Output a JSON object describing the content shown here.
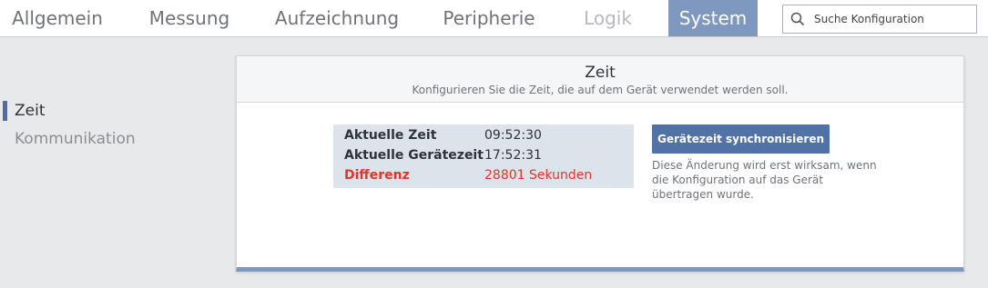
{
  "nav": {
    "tabs": [
      {
        "label": "Allgemein",
        "state": "normal"
      },
      {
        "label": "Messung",
        "state": "normal"
      },
      {
        "label": "Aufzeichnung",
        "state": "normal"
      },
      {
        "label": "Peripherie",
        "state": "normal"
      },
      {
        "label": "Logik",
        "state": "disabled"
      },
      {
        "label": "System",
        "state": "active"
      }
    ],
    "search": {
      "placeholder": "Suche Konfiguration",
      "icon": "search-icon"
    }
  },
  "sidebar": {
    "items": [
      {
        "label": "Zeit",
        "active": true
      },
      {
        "label": "Kommunikation",
        "active": false
      }
    ]
  },
  "card": {
    "title": "Zeit",
    "subtitle": "Konfigurieren Sie die Zeit, die auf dem Gerät verwendet werden soll.",
    "rows": [
      {
        "label": "Aktuelle Zeit",
        "value": "09:52:30"
      },
      {
        "label": "Aktuelle Gerätezeit",
        "value": "17:52:31"
      },
      {
        "label": "Differenz",
        "value": "28801 Sekunden"
      }
    ],
    "sync_button": "Gerätezeit synchronisieren",
    "note": "Diese Änderung wird erst wirksam, wenn die Konfiguration auf das Gerät übertragen wurde."
  },
  "colors": {
    "accent": "#7f98bf",
    "button": "#5072a7",
    "error": "#e0352b"
  }
}
